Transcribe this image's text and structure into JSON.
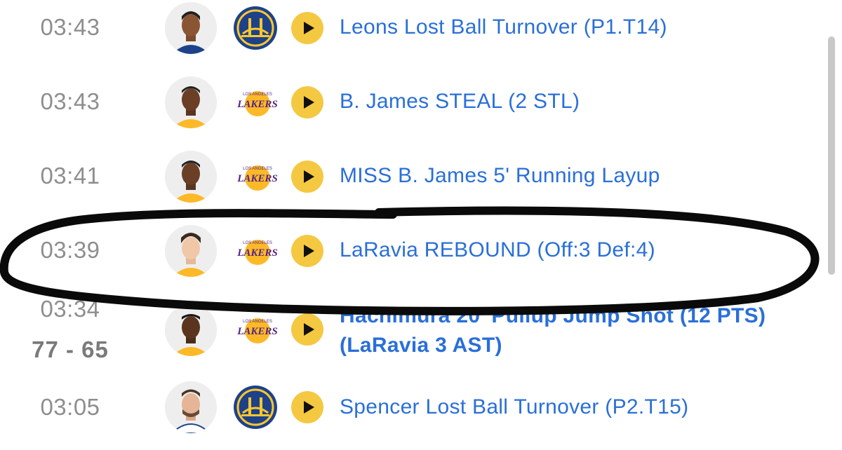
{
  "plays": [
    {
      "time": "03:43",
      "team": "warriors",
      "description": "Leons Lost Ball Turnover (P1.T14)"
    },
    {
      "time": "03:43",
      "team": "lakers",
      "lakers_text": "LAKERS",
      "la_text": "LOS ANGELES",
      "description": "B. James STEAL (2 STL)"
    },
    {
      "time": "03:41",
      "team": "lakers",
      "lakers_text": "LAKERS",
      "la_text": "LOS ANGELES",
      "description": "MISS B. James 5' Running Layup"
    },
    {
      "time": "03:39",
      "team": "lakers",
      "lakers_text": "LAKERS",
      "la_text": "LOS ANGELES",
      "description": "LaRavia REBOUND (Off:3 Def:4)"
    },
    {
      "time": "03:34",
      "score": "77 - 65",
      "team": "lakers",
      "lakers_text": "LAKERS",
      "la_text": "LOS ANGELES",
      "description": "Hachimura 20' Pullup Jump Shot (12 PTS) (LaRavia 3 AST)"
    },
    {
      "time": "03:05",
      "team": "warriors",
      "description": "Spencer Lost Ball Turnover (P2.T15)"
    }
  ],
  "colors": {
    "time_gray": "#8e8e8e",
    "link_blue": "#2a6fd8",
    "play_yellow": "#f5c842",
    "warriors_blue": "#1d428a",
    "warriors_gold": "#ffc72c",
    "lakers_purple": "#552583",
    "lakers_gold": "#fdb927"
  }
}
